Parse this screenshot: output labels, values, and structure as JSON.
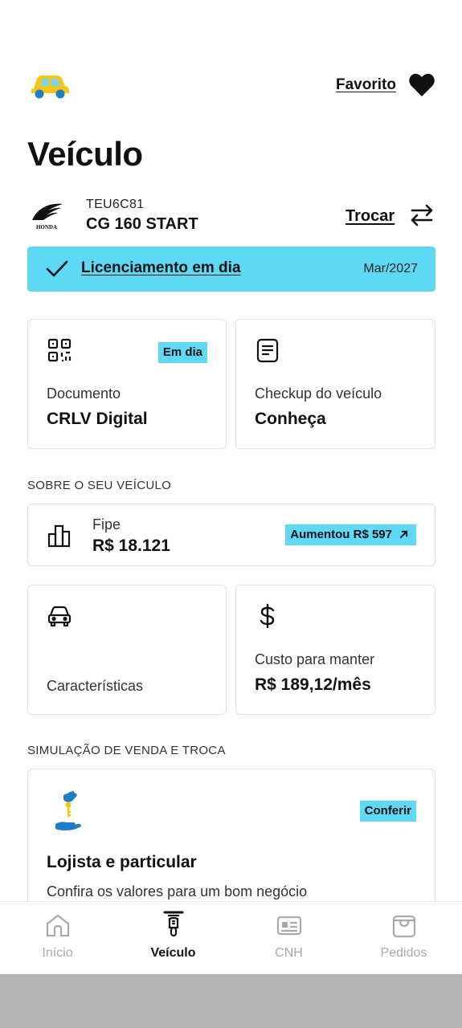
{
  "header": {
    "favorite_label": "Favorito",
    "page_title": "Veículo"
  },
  "vehicle": {
    "plate": "TEU6C81",
    "model": "CG 160 START",
    "brand_logo_text": "HONDA",
    "swap_label": "Trocar"
  },
  "license": {
    "label": "Licenciamento em dia",
    "date": "Mar/2027"
  },
  "cards": {
    "document": {
      "badge": "Em dia",
      "subtitle": "Documento",
      "title": "CRLV Digital"
    },
    "checkup": {
      "subtitle": "Checkup do veículo",
      "title": "Conheça"
    }
  },
  "about": {
    "section_label": "SOBRE O SEU VEÍCULO",
    "fipe": {
      "label": "Fipe",
      "value": "R$ 18.121",
      "badge": "Aumentou R$ 597"
    },
    "features": {
      "label": "Características"
    },
    "cost": {
      "subtitle": "Custo para manter",
      "value": "R$ 189,12/mês"
    }
  },
  "simulation": {
    "section_label": "SIMULAÇÃO DE VENDA E TROCA",
    "badge": "Conferir",
    "title": "Lojista e particular",
    "subtitle": "Confira os valores para um bom negócio"
  },
  "bottom_nav": {
    "items": [
      {
        "label": "Início",
        "icon": "home-icon"
      },
      {
        "label": "Veículo",
        "icon": "motorcycle-icon"
      },
      {
        "label": "CNH",
        "icon": "id-card-icon"
      },
      {
        "label": "Pedidos",
        "icon": "shopping-bag-icon"
      }
    ],
    "active_index": 1
  },
  "colors": {
    "accent": "#5dd8f5",
    "text": "#111111",
    "car_yellow": "#f5c518",
    "car_blue": "#1e7fc4",
    "inactive_nav": "#aaaaaa"
  }
}
